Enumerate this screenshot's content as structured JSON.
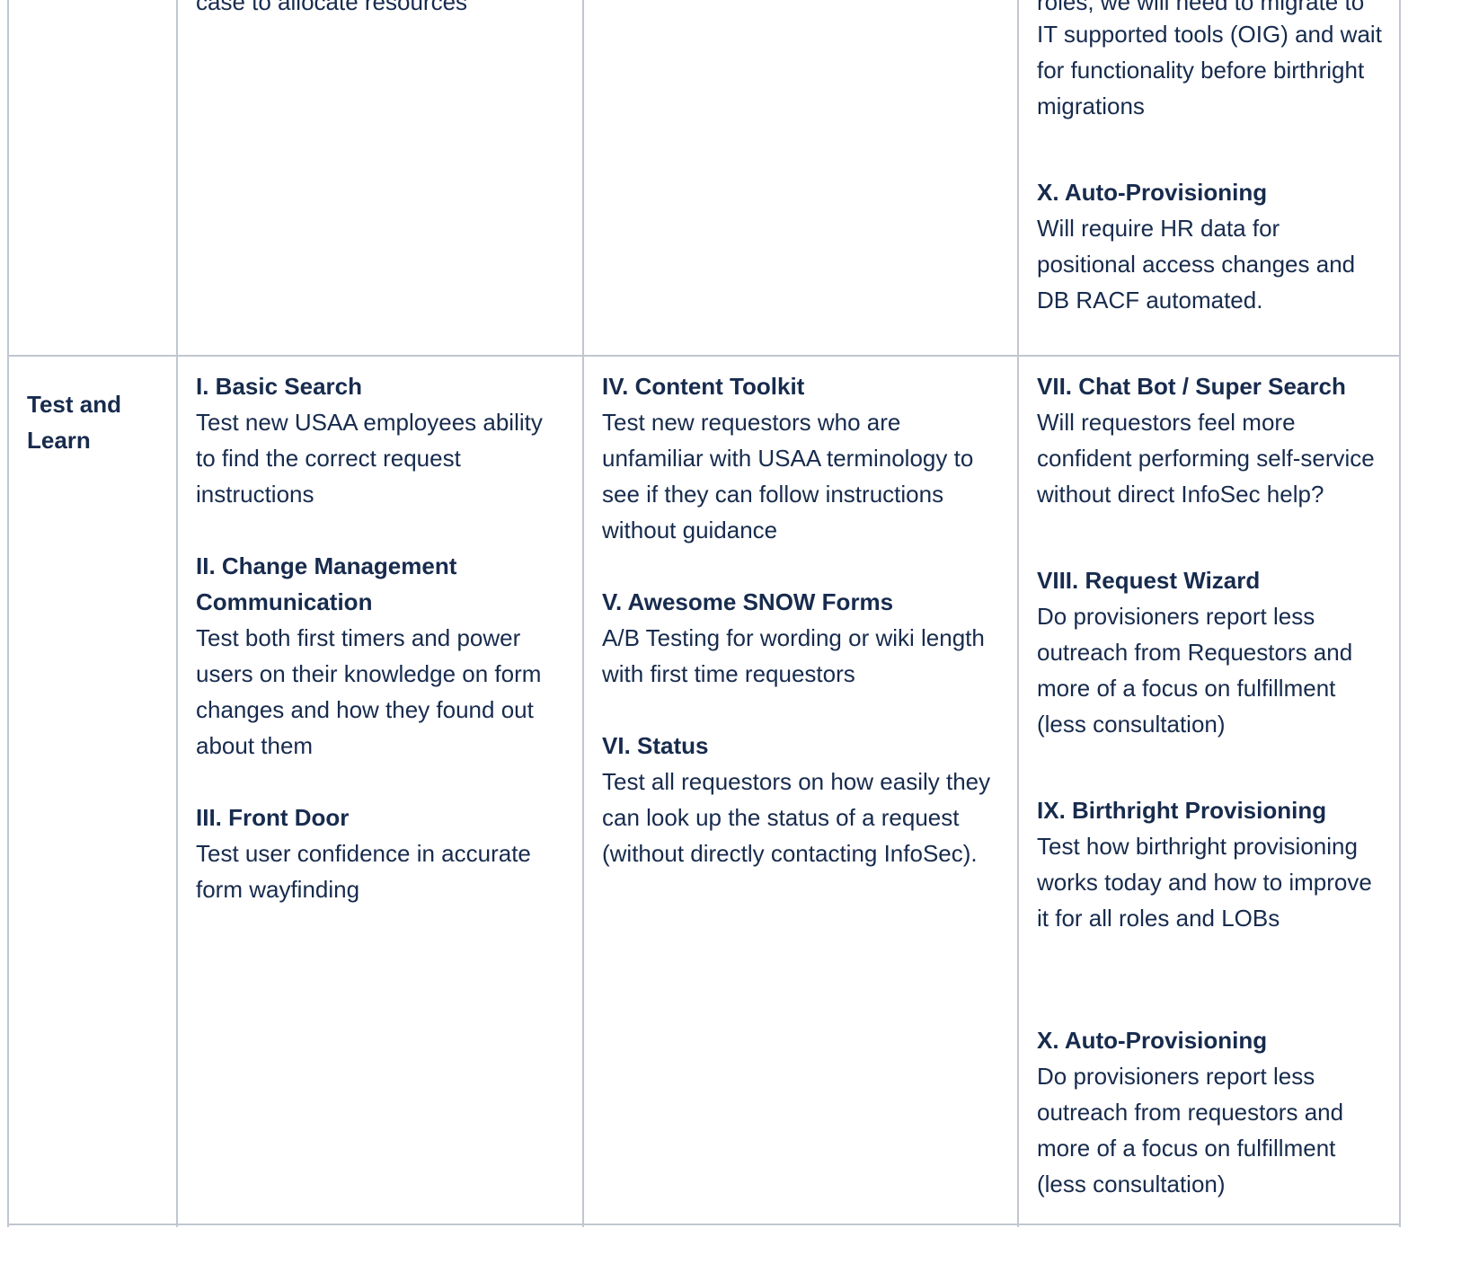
{
  "top_row": {
    "col1_tail": "case to allocate resources",
    "col3_tail_first": "roles, we will need to migrate to",
    "col3_tail_rest": "IT supported tools (OIG) and wait for functionality before birthright migrations",
    "col3_item": {
      "title": "X. Auto-Provisioning",
      "text": "Will require HR data for positional access changes and DB RACF automated."
    }
  },
  "test_row": {
    "label": "Test and Learn",
    "col1": [
      {
        "title": "I. Basic Search",
        "text": "Test new USAA employees ability to find the correct request instructions"
      },
      {
        "title": "II. Change Management Communication",
        "text": "Test both first timers and power users on their knowledge on form changes and how they found out about them"
      },
      {
        "title": "III. Front Door",
        "text": "Test user confidence in accurate form wayfinding"
      }
    ],
    "col2": [
      {
        "title": "IV. Content Toolkit",
        "text": "Test new requestors who are unfamiliar with USAA terminology to see if they can follow instructions without guidance"
      },
      {
        "title": "V. Awesome SNOW Forms",
        "text": "A/B Testing for wording or wiki length with first time requestors"
      },
      {
        "title": "VI. Status",
        "text": "Test all requestors on how easily they can look up the status of a request (without directly contacting InfoSec)."
      }
    ],
    "col3": [
      {
        "title": "VII. Chat Bot / Super Search",
        "text": "Will requestors feel more confident performing self-service without direct InfoSec help?"
      },
      {
        "title": "VIII. Request Wizard",
        "text": "Do provisioners report less outreach from Requestors and more of a focus on fulfillment (less consultation)"
      },
      {
        "title": "IX. Birthright Provisioning",
        "text": "Test how birthright provisioning works today and how to improve it for all roles and LOBs"
      },
      {
        "title": "X. Auto-Provisioning",
        "text": "Do provisioners report less outreach from requestors and more of a focus on fulfillment (less consultation)"
      }
    ]
  }
}
